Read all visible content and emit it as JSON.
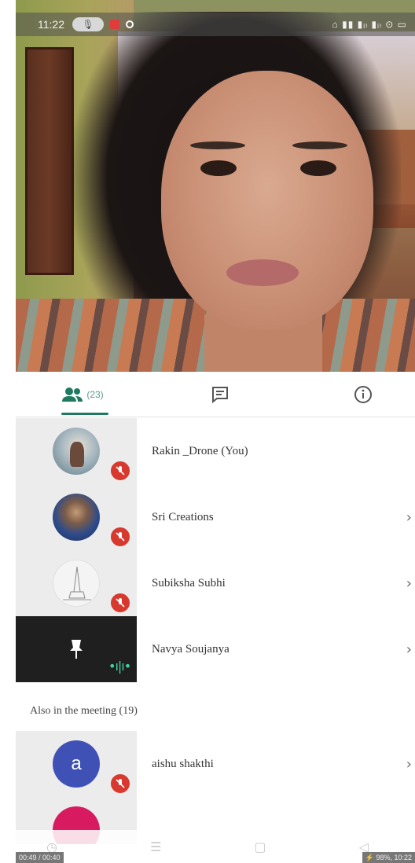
{
  "status_bar": {
    "time": "11:22",
    "indicators": "⌂ ▮▮ ▮ᵢₗ ▮ᵢₗ ⊙ ▭"
  },
  "tabs": {
    "people": {
      "icon": "people-icon",
      "count": "(23)"
    },
    "chat": {
      "icon": "chat-icon"
    },
    "info": {
      "icon": "info-icon"
    }
  },
  "participants": [
    {
      "name": "Rakin _Drone (You)",
      "muted": true,
      "has_chevron": false
    },
    {
      "name": "Sri Creations",
      "muted": true,
      "has_chevron": true
    },
    {
      "name": "Subiksha Subhi",
      "muted": true,
      "has_chevron": true
    },
    {
      "name": "Navya Soujanya",
      "muted": false,
      "speaking": true,
      "has_chevron": true
    }
  ],
  "also_in_meeting": {
    "title": "Also in the meeting (19)",
    "items": [
      {
        "name": "aishu shakthi",
        "avatar_letter": "a",
        "muted": true,
        "has_chevron": true
      }
    ]
  },
  "colors": {
    "accent": "#1e7a5f",
    "mute_badge": "#d8392e",
    "avatar_a": "#3f51b5",
    "avatar_next": "#d81b60"
  },
  "overlay": {
    "left_stamp": "00:49 / 00:40",
    "right_stamp": "⚡ 98%, 10:22"
  },
  "chevron": "›"
}
